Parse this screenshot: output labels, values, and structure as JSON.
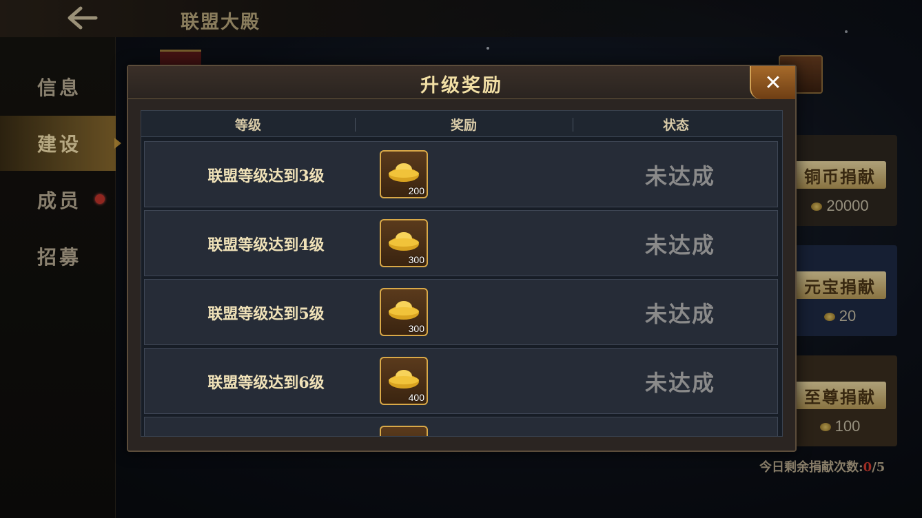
{
  "header": {
    "title": "联盟大殿",
    "back_icon": "back-arrow-icon"
  },
  "sidebar": {
    "items": [
      {
        "label": "信息",
        "active": false
      },
      {
        "label": "建设",
        "active": true
      },
      {
        "label": "成员",
        "active": false
      },
      {
        "label": "招募",
        "active": false,
        "badge": true
      }
    ]
  },
  "background": {
    "donations": [
      {
        "button": "铜币捐献",
        "cost": "20000",
        "cost_icon": "copper-coin-icon"
      },
      {
        "button": "元宝捐献",
        "cost": "20",
        "cost_icon": "ingot-icon"
      },
      {
        "button": "至尊捐献",
        "cost": "100",
        "cost_icon": "ingot-icon"
      }
    ],
    "remaining_label": "今日剩余捐献次数:",
    "remaining_used": "0",
    "remaining_total": "/5"
  },
  "dialog": {
    "title": "升级奖励",
    "close_icon": "close-icon",
    "columns": [
      "等级",
      "奖励",
      "状态"
    ],
    "rows": [
      {
        "level": "联盟等级达到3级",
        "reward_icon": "gold-ingot-icon",
        "reward_qty": "200",
        "status": "未达成"
      },
      {
        "level": "联盟等级达到4级",
        "reward_icon": "gold-ingot-icon",
        "reward_qty": "300",
        "status": "未达成"
      },
      {
        "level": "联盟等级达到5级",
        "reward_icon": "gold-ingot-icon",
        "reward_qty": "300",
        "status": "未达成"
      },
      {
        "level": "联盟等级达到6级",
        "reward_icon": "gold-ingot-icon",
        "reward_qty": "400",
        "status": "未达成"
      }
    ]
  },
  "colors": {
    "accent_gold": "#d9a948",
    "status_gray": "#8a8a8a",
    "badge_red": "#c0332a"
  }
}
